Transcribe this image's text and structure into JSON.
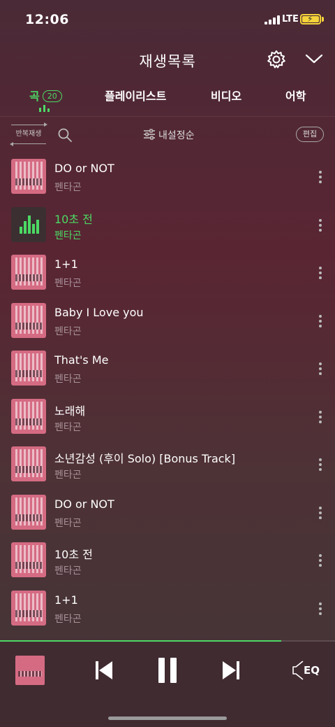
{
  "status": {
    "time": "12:06",
    "network": "LTE"
  },
  "header": {
    "title": "재생목록",
    "icons": [
      "settings-icon",
      "chevron-down-icon"
    ]
  },
  "tabs": [
    {
      "label": "곡",
      "count": "20",
      "active": true
    },
    {
      "label": "플레이리스트"
    },
    {
      "label": "비디오"
    },
    {
      "label": "어학"
    }
  ],
  "toolbar": {
    "repeat_label": "반복재생",
    "sort_label": "내설정순",
    "edit_label": "편집"
  },
  "songs": [
    {
      "title": "DO or NOT",
      "artist": "펜타곤"
    },
    {
      "title": "10초 전",
      "artist": "펜타곤",
      "playing": true
    },
    {
      "title": "1+1",
      "artist": "펜타곤"
    },
    {
      "title": "Baby I Love you",
      "artist": "펜타곤"
    },
    {
      "title": "That's Me",
      "artist": "펜타곤"
    },
    {
      "title": "노래해",
      "artist": "펜타곤"
    },
    {
      "title": "소년감성 (후이 Solo) [Bonus Track]",
      "artist": "펜타곤"
    },
    {
      "title": "DO or NOT",
      "artist": "펜타곤"
    },
    {
      "title": "10초 전",
      "artist": "펜타곤"
    },
    {
      "title": "1+1",
      "artist": "펜타곤"
    }
  ],
  "player": {
    "progress": 0.84,
    "eq_label": "EQ"
  },
  "colors": {
    "accent": "#4cd964",
    "background": "#4f2a36",
    "thumb": "#d56b83"
  }
}
